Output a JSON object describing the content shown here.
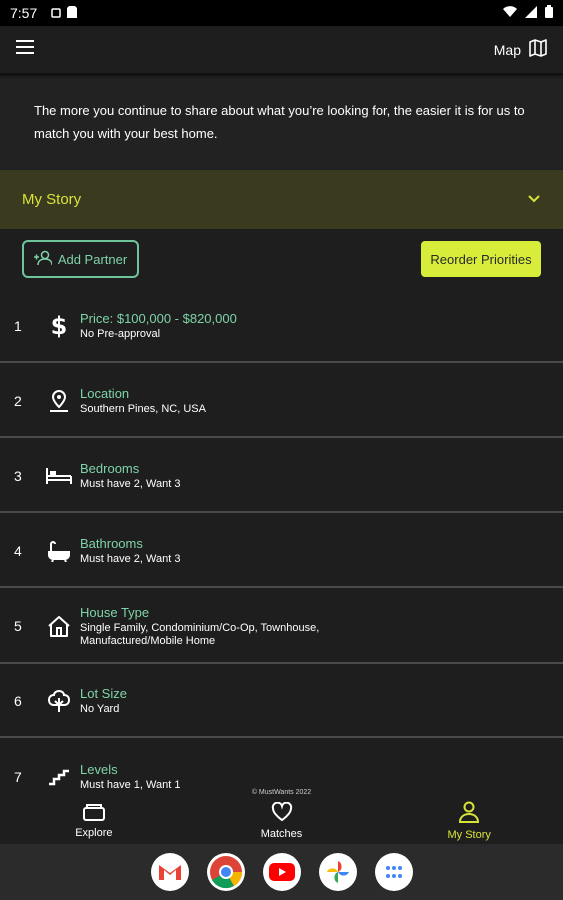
{
  "status_bar": {
    "time": "7:57"
  },
  "app_bar": {
    "menu_icon": "menu-icon",
    "map_label": "Map",
    "map_icon": "map-icon"
  },
  "intro": {
    "text": "The more you continue to share about what you’re looking for, the easier it is for us to match you with your best home."
  },
  "story_section": {
    "title": "My Story",
    "chevron": "chevron-down-icon"
  },
  "actions": {
    "add_partner_label": "Add Partner",
    "reorder_label": "Reorder Priorities"
  },
  "priorities": [
    {
      "num": "1",
      "icon": "dollar-icon",
      "title": "Price: $100,000 - $820,000",
      "sub": "No Pre-approval"
    },
    {
      "num": "2",
      "icon": "location-pin-icon",
      "title": "Location",
      "sub": "Southern Pines, NC, USA"
    },
    {
      "num": "3",
      "icon": "bed-icon",
      "title": "Bedrooms",
      "sub": "Must have 2, Want 3"
    },
    {
      "num": "4",
      "icon": "bathtub-icon",
      "title": "Bathrooms",
      "sub": "Must have 2, Want 3"
    },
    {
      "num": "5",
      "icon": "house-icon",
      "title": "House Type",
      "sub": "Single Family, Condominium/Co-Op, Townhouse, Manufactured/Mobile Home"
    },
    {
      "num": "6",
      "icon": "tree-icon",
      "title": "Lot Size",
      "sub": "No Yard"
    },
    {
      "num": "7",
      "icon": "stairs-icon",
      "title": "Levels",
      "sub": "Must have 1, Want 1"
    }
  ],
  "copyright": "© MustWants 2022",
  "bottom_nav": [
    {
      "label": "Explore",
      "icon": "explore-icon",
      "active": false
    },
    {
      "label": "Matches",
      "icon": "heart-icon",
      "active": false
    },
    {
      "label": "My Story",
      "icon": "person-icon",
      "active": true
    }
  ],
  "dock": [
    "gmail-icon",
    "chrome-icon",
    "youtube-icon",
    "photos-icon",
    "apps-icon"
  ],
  "colors": {
    "accent_yellow": "#d8e33a",
    "accent_green": "#7fd3a8",
    "background": "#1e1e1e",
    "story_bar": "#3a3a1f"
  }
}
